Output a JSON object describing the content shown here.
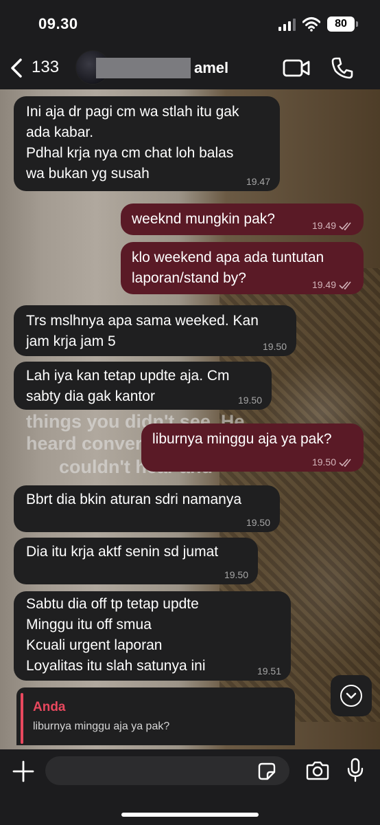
{
  "status_bar": {
    "time": "09.30",
    "battery": "80"
  },
  "header": {
    "back_count": "133",
    "contact_name": "amel"
  },
  "background_caption": [
    "things you didn't see. He",
    "heard conver",
    "couldn't hear and"
  ],
  "messages": [
    {
      "direction": "incoming",
      "text": "Ini aja dr pagi cm wa stlah itu gak\nada kabar.\nPdhal krja nya cm chat loh  balas\nwa bukan yg  susah",
      "time": "19.47"
    },
    {
      "direction": "outgoing",
      "text": "weeknd mungkin pak?",
      "time": "19.49"
    },
    {
      "direction": "outgoing",
      "text": "klo weekend apa ada tuntutan\nlaporan/stand by?",
      "time": "19.49"
    },
    {
      "direction": "incoming",
      "text": "Trs mslhnya apa sama weeked. Kan\njam krja  jam 5",
      "time": "19.50"
    },
    {
      "direction": "incoming",
      "text": "Lah iya kan tetap updte aja.  Cm\nsabty dia gak kantor",
      "time": "19.50"
    },
    {
      "direction": "outgoing",
      "text": "liburnya minggu aja ya pak?",
      "time": "19.50"
    },
    {
      "direction": "incoming",
      "text": "Bbrt dia bkin aturan sdri namanya",
      "time": "19.50"
    },
    {
      "direction": "incoming",
      "text": "Dia itu krja aktf senin sd jumat",
      "time": "19.50"
    },
    {
      "direction": "incoming",
      "text": "Sabtu dia off tp tetap updte\nMinggu itu off smua\nKcuali urgent laporan\nLoyalitas itu slah satunya ini",
      "time": "19.51"
    }
  ],
  "reply_preview": {
    "author": "Anda",
    "text": "liburnya minggu aja ya pak?"
  },
  "input": {
    "placeholder": "",
    "value": ""
  },
  "colors": {
    "incoming_bubble": "#1f1f20",
    "outgoing_bubble": "#5a1a26",
    "reply_accent": "#e8485e"
  },
  "icons": [
    "back-chevron-icon",
    "video-call-icon",
    "phone-icon",
    "scroll-down-icon",
    "plus-icon",
    "sticker-icon",
    "camera-icon",
    "microphone-icon"
  ]
}
